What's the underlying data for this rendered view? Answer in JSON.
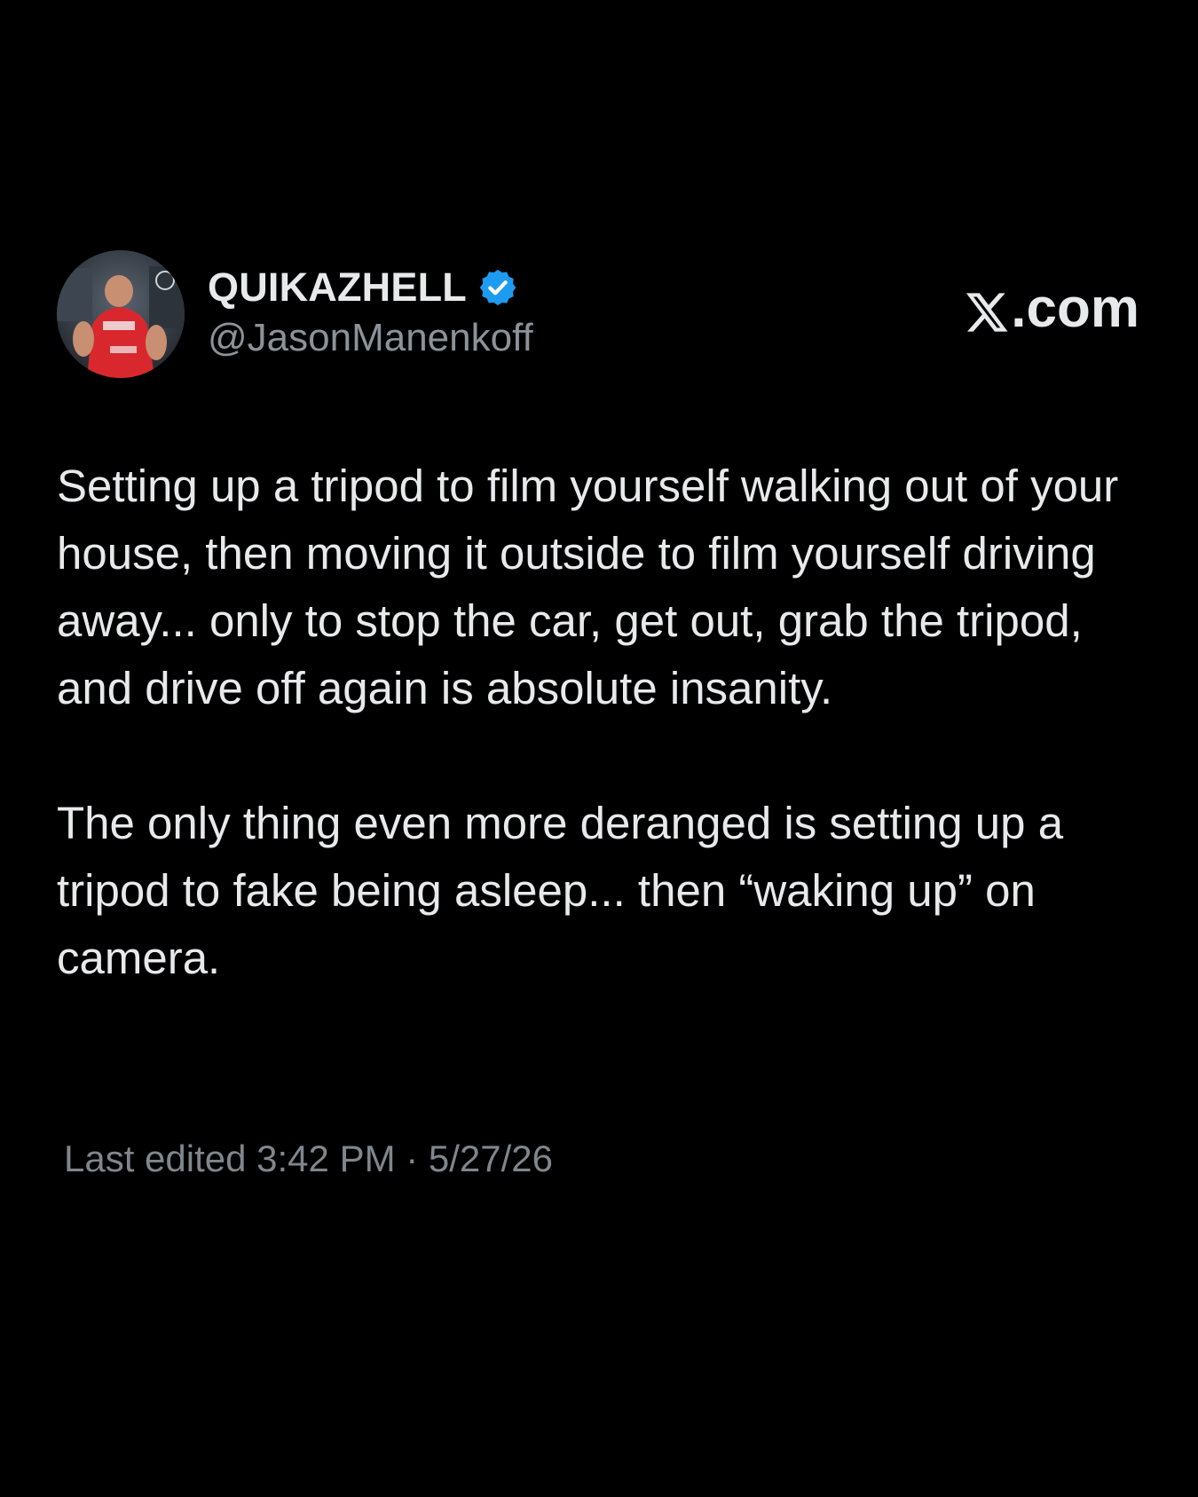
{
  "author": {
    "display_name": "QUIKAZHELL",
    "handle": "@JasonManenkoff",
    "verified_icon": "verified-badge-icon",
    "verified_color": "#1d9bf0"
  },
  "brand": {
    "label": ".com",
    "icon": "x-logo-icon"
  },
  "tweet": {
    "paragraphs": [
      "Setting up a tripod to film yourself walking out of your house, then moving it outside to film yourself driving away... only to stop the car, get out, grab the tripod, and drive off again is absolute insanity.",
      "The only thing even more deranged is setting up a tripod to fake being asleep... then “waking up” on camera."
    ],
    "timestamp": "Last edited 3:42 PM · 5/27/26"
  },
  "colors": {
    "background": "#000000",
    "text": "#e7e9ea",
    "muted": "#8b9298"
  }
}
